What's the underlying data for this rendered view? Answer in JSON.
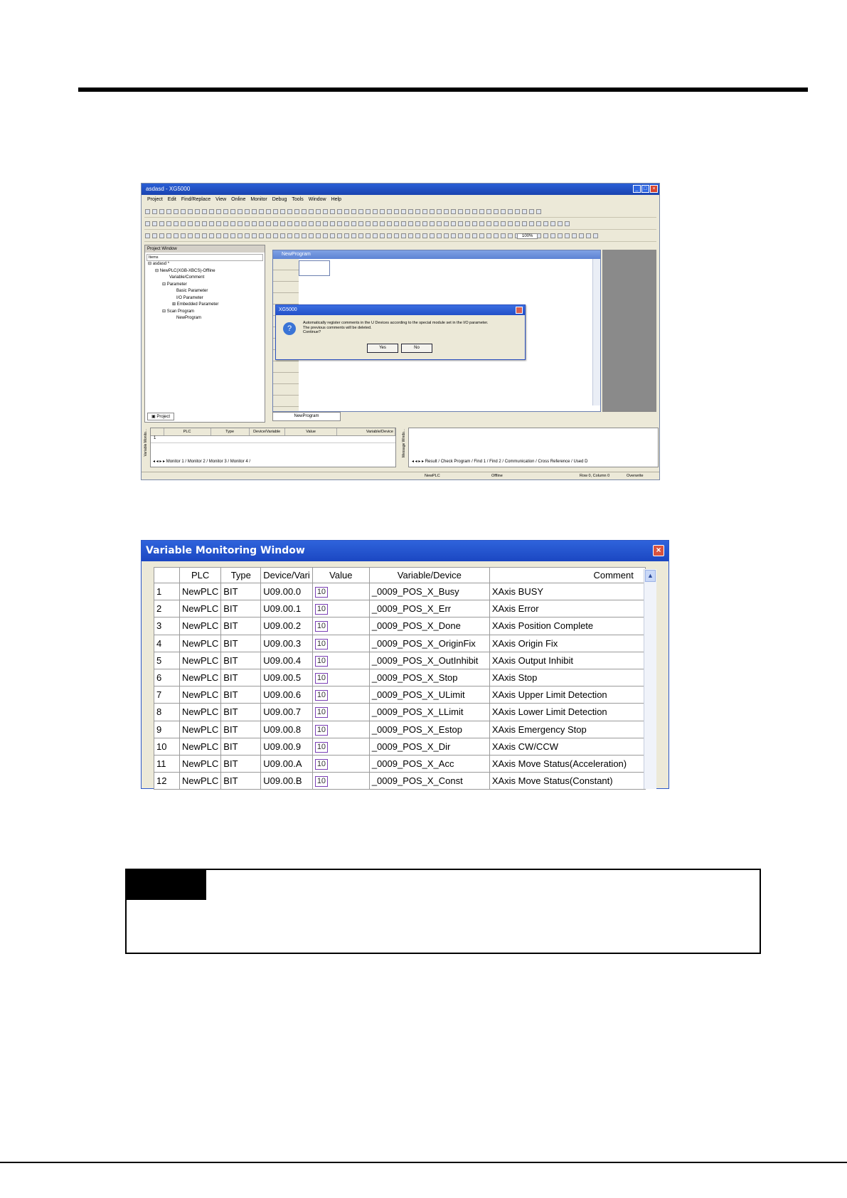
{
  "app": {
    "title": "asdasd - XG5000",
    "menu": [
      "Project",
      "Edit",
      "Find/Replace",
      "View",
      "Online",
      "Monitor",
      "Debug",
      "Tools",
      "Window",
      "Help"
    ],
    "zoom": "100%",
    "project_window": {
      "title": "Project Window",
      "header": "Items",
      "tree": [
        "asdasd *",
        "NewPLC(XGB-XBCS)-Offline",
        "Variable/Comment",
        "Parameter",
        "Basic Parameter",
        "I/O Parameter",
        "Embedded Parameter",
        "Scan Program",
        "NewProgram"
      ],
      "tab": "Project"
    },
    "program_window": {
      "title": "NewProgram",
      "tab": "NewProgram"
    },
    "dialog": {
      "title": "XG5000",
      "message": [
        "Automatically register comments in the U Devices according to the special module set in the I/O parameter.",
        "The previous comments will be deleted.",
        "Continue?"
      ],
      "yes": "Yes",
      "no": "No"
    },
    "monitor_columns": [
      "PLC",
      "Type",
      "Device/Variable",
      "Value",
      "Variable/Device"
    ],
    "monitor_row": "1",
    "monitor_tabs": "Monitor 1 / Monitor 2 / Monitor 3 / Monitor 4 /",
    "side_label_left": "Variable Monito...",
    "side_label_right": "Message Windo...",
    "message_tabs": "Result / Check Program / Find 1 / Find 2 / Communication / Cross Reference / Used D",
    "status": {
      "plc": "NewPLC",
      "mode": "Offline",
      "position": "Row 0, Column 0",
      "insert": "Overwrite"
    }
  },
  "vmw": {
    "title": "Variable Monitoring Window",
    "columns": [
      "",
      "PLC",
      "Type",
      "Device/Vari",
      "Value",
      "Variable/Device",
      "Comment"
    ],
    "value_icon": "10",
    "rows": [
      {
        "no": "1",
        "plc": "NewPLC",
        "type": "BIT",
        "device": "U09.00.0",
        "variable": "_0009_POS_X_Busy",
        "comment": "XAxis BUSY"
      },
      {
        "no": "2",
        "plc": "NewPLC",
        "type": "BIT",
        "device": "U09.00.1",
        "variable": "_0009_POS_X_Err",
        "comment": "XAxis Error"
      },
      {
        "no": "3",
        "plc": "NewPLC",
        "type": "BIT",
        "device": "U09.00.2",
        "variable": "_0009_POS_X_Done",
        "comment": "XAxis Position Complete"
      },
      {
        "no": "4",
        "plc": "NewPLC",
        "type": "BIT",
        "device": "U09.00.3",
        "variable": "_0009_POS_X_OriginFix",
        "comment": "XAxis Origin Fix"
      },
      {
        "no": "5",
        "plc": "NewPLC",
        "type": "BIT",
        "device": "U09.00.4",
        "variable": "_0009_POS_X_OutInhibit",
        "comment": "XAxis Output Inhibit"
      },
      {
        "no": "6",
        "plc": "NewPLC",
        "type": "BIT",
        "device": "U09.00.5",
        "variable": "_0009_POS_X_Stop",
        "comment": "XAxis Stop"
      },
      {
        "no": "7",
        "plc": "NewPLC",
        "type": "BIT",
        "device": "U09.00.6",
        "variable": "_0009_POS_X_ULimit",
        "comment": "XAxis Upper Limit Detection"
      },
      {
        "no": "8",
        "plc": "NewPLC",
        "type": "BIT",
        "device": "U09.00.7",
        "variable": "_0009_POS_X_LLimit",
        "comment": "XAxis Lower Limit Detection"
      },
      {
        "no": "9",
        "plc": "NewPLC",
        "type": "BIT",
        "device": "U09.00.8",
        "variable": "_0009_POS_X_Estop",
        "comment": "XAxis Emergency Stop"
      },
      {
        "no": "10",
        "plc": "NewPLC",
        "type": "BIT",
        "device": "U09.00.9",
        "variable": "_0009_POS_X_Dir",
        "comment": "XAxis CW/CCW"
      },
      {
        "no": "11",
        "plc": "NewPLC",
        "type": "BIT",
        "device": "U09.00.A",
        "variable": "_0009_POS_X_Acc",
        "comment": "XAxis Move Status(Acceleration)"
      },
      {
        "no": "12",
        "plc": "NewPLC",
        "type": "BIT",
        "device": "U09.00.B",
        "variable": "_0009_POS_X_Const",
        "comment": "XAxis Move Status(Constant)"
      }
    ]
  }
}
